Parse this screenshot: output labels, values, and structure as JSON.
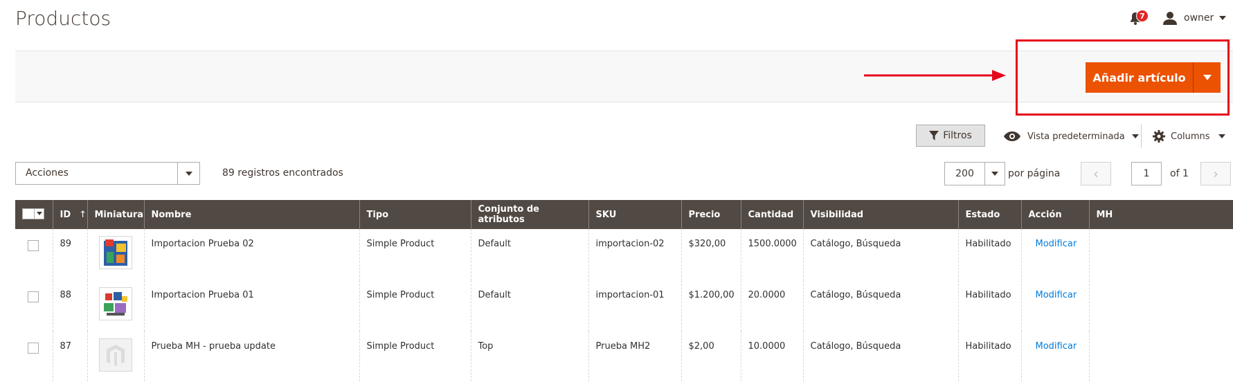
{
  "header": {
    "title": "Productos",
    "notifications_count": "7",
    "user_name": "owner"
  },
  "action_bar": {
    "add_button_label": "Añadir artículo"
  },
  "toolbar": {
    "filters_label": "Filtros",
    "view_label": "Vista predeterminada",
    "columns_label": "Columns",
    "mass_actions_label": "Acciones",
    "records_found": "89 registros encontrados",
    "per_page_value": "200",
    "per_page_label": "por página",
    "current_page": "1",
    "of_pages": "of 1"
  },
  "table": {
    "columns": [
      "ID",
      "Miniatura",
      "Nombre",
      "Tipo",
      "Conjunto de atributos",
      "SKU",
      "Precio",
      "Cantidad",
      "Visibilidad",
      "Estado",
      "Acción",
      "MH"
    ],
    "sort_indicator": "↑",
    "action_link": "Modificar",
    "rows": [
      {
        "id": "89",
        "name": "Importacion Prueba 02",
        "type": "Simple Product",
        "attribute_set": "Default",
        "sku": "importacion-02",
        "price": "$320,00",
        "qty": "1500.0000",
        "visibility": "Catálogo, Búsqueda",
        "status": "Habilitado",
        "mh": "",
        "thumbnail": "product-image-icon"
      },
      {
        "id": "88",
        "name": "Importacion Prueba 01",
        "type": "Simple Product",
        "attribute_set": "Default",
        "sku": "importacion-01",
        "price": "$1.200,00",
        "qty": "20.0000",
        "visibility": "Catálogo, Búsqueda",
        "status": "Habilitado",
        "mh": "",
        "thumbnail": "product-image-icon"
      },
      {
        "id": "87",
        "name": "Prueba MH - prueba update",
        "type": "Simple Product",
        "attribute_set": "Top",
        "sku": "Prueba MH2",
        "price": "$2,00",
        "qty": "10.0000",
        "visibility": "Catálogo, Búsqueda",
        "status": "Habilitado",
        "mh": "",
        "thumbnail": "placeholder-logo-icon"
      }
    ]
  },
  "colors": {
    "accent": "#eb5202",
    "table_header": "#514943",
    "link": "#007bdb",
    "badge": "#e22626",
    "annotation": "#e5081b"
  }
}
